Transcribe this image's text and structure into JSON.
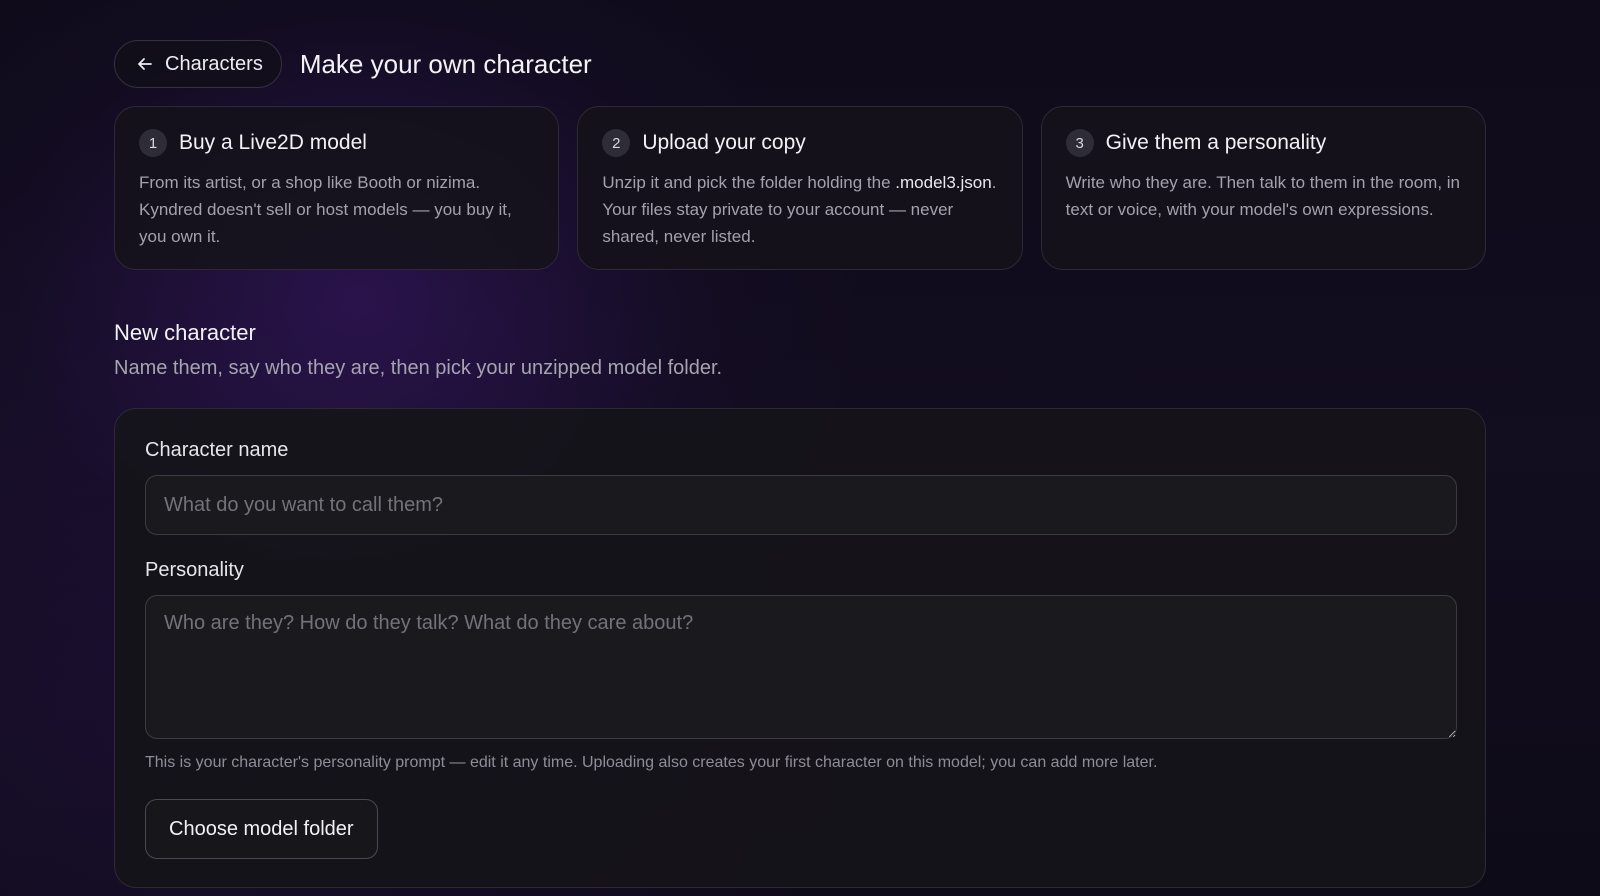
{
  "header": {
    "back_label": "Characters",
    "back_icon": "arrow-left-icon",
    "title": "Make your own character"
  },
  "steps": [
    {
      "number": "1",
      "title": "Buy a Live2D model",
      "body_before": "From its artist, or a shop like Booth or nizima. Kyndred doesn't sell or host models — you buy it, you own it.",
      "code": "",
      "body_after": ""
    },
    {
      "number": "2",
      "title": "Upload your copy",
      "body_before": "Unzip it and pick the folder holding the ",
      "code": ".model3.json",
      "body_after": ". Your files stay private to your account — never shared, never listed."
    },
    {
      "number": "3",
      "title": "Give them a personality",
      "body_before": "Write who they are. Then talk to them in the room, in text or voice, with your model's own expressions.",
      "code": "",
      "body_after": ""
    }
  ],
  "new_character": {
    "title": "New character",
    "subtitle": "Name them, say who they are, then pick your unzipped model folder.",
    "name_label": "Character name",
    "name_value": "",
    "name_placeholder": "What do you want to call them?",
    "personality_label": "Personality",
    "personality_value": "",
    "personality_placeholder": "Who are they? How do they talk? What do they care about?",
    "help_text": "This is your character's personality prompt — edit it any time. Uploading also creates your first character on this model; you can add more later.",
    "choose_button_label": "Choose model folder"
  },
  "colors": {
    "background": "#110c1d",
    "accent_glow": "#3c186e",
    "card_background": "#15141a",
    "border": "#2d2a36",
    "text_primary": "#ececf1",
    "text_secondary": "#a3a1ad"
  }
}
